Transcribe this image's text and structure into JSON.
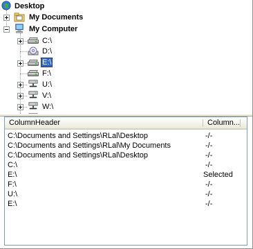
{
  "tree": {
    "nodes": [
      {
        "label": "Desktop"
      },
      {
        "label": "My Documents"
      },
      {
        "label": "My Computer"
      },
      {
        "label": "C:\\"
      },
      {
        "label": "D:\\"
      },
      {
        "label": "E:\\"
      },
      {
        "label": "F:\\"
      },
      {
        "label": "U:\\"
      },
      {
        "label": "V:\\"
      },
      {
        "label": "W:\\"
      }
    ],
    "selected": "E:\\"
  },
  "list": {
    "columns": [
      "ColumnHeader",
      "Column..."
    ],
    "rows": [
      {
        "path": "C:\\Documents and Settings\\RLal\\Desktop",
        "value": "-/-"
      },
      {
        "path": "C:\\Documents and Settings\\RLal\\My Documents",
        "value": "-/-"
      },
      {
        "path": "C:\\Documents and Settings\\RLal\\Desktop",
        "value": "-/-"
      },
      {
        "path": "C:\\",
        "value": "-/-"
      },
      {
        "path": "E:\\",
        "value": "Selected"
      },
      {
        "path": "F:\\",
        "value": "-/-"
      },
      {
        "path": "U:\\",
        "value": "-/-"
      },
      {
        "path": "E:\\",
        "value": "-/-"
      }
    ]
  },
  "icons": {
    "desktop": "desktop-icon",
    "my_documents": "folder-icon",
    "my_computer": "computer-icon",
    "drive": "hard-drive-icon",
    "cdrom": "cd-drive-icon",
    "network_drive": "network-drive-icon"
  },
  "colors": {
    "selection": "#316ac5",
    "header_gradient_end": "#ebeadb",
    "list_border": "#7f9db9"
  }
}
